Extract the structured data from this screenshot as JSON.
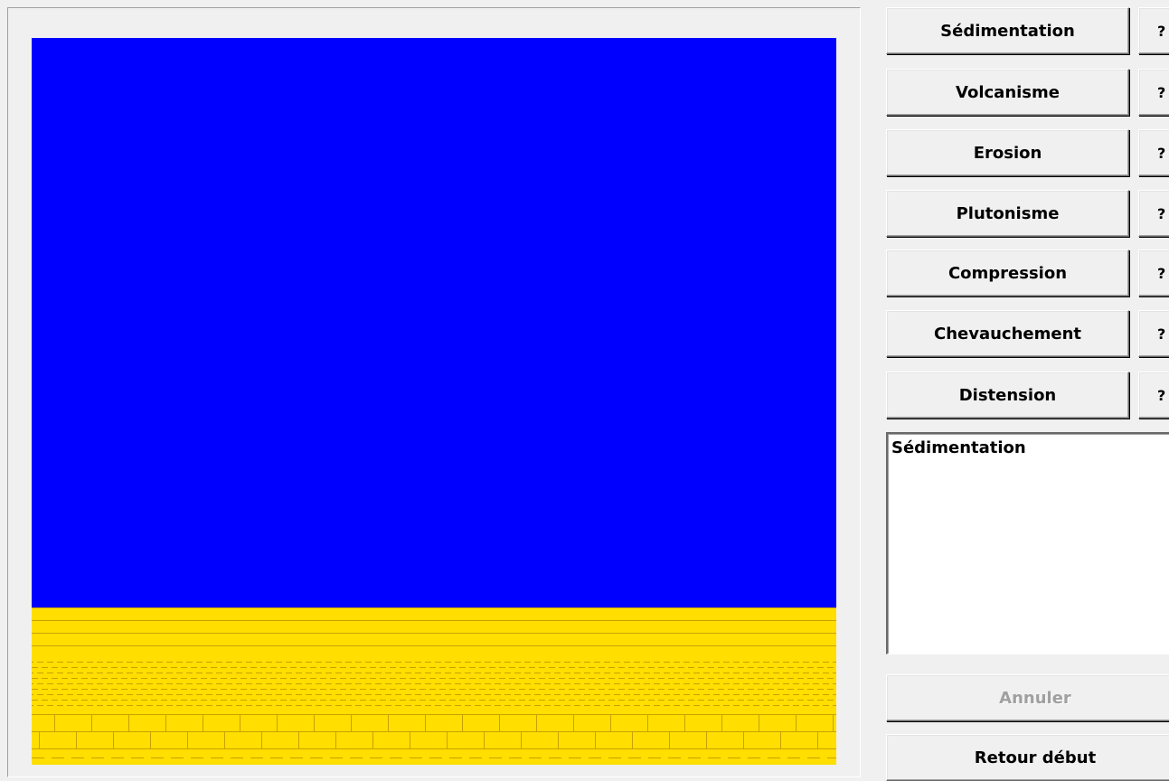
{
  "operations": [
    {
      "label": "Sédimentation",
      "help": "?"
    },
    {
      "label": "Volcanisme",
      "help": "?"
    },
    {
      "label": "Erosion",
      "help": "?"
    },
    {
      "label": "Plutonisme",
      "help": "?"
    },
    {
      "label": "Compression",
      "help": "?"
    },
    {
      "label": "Chevauchement",
      "help": "?"
    },
    {
      "label": "Distension",
      "help": "?"
    }
  ],
  "history": [
    "Sédimentation"
  ],
  "actions": {
    "undo_label": "Annuler",
    "undo_enabled": false,
    "restart_label": "Retour début"
  },
  "colors": {
    "sky_water": "#0000ff",
    "sediment": "#ffde00",
    "sediment_lines": "#c8a200"
  },
  "strata": [
    {
      "type": "horizontal-lines",
      "pattern": "sandstone"
    },
    {
      "type": "dashed-lines",
      "pattern": "clay"
    },
    {
      "type": "brick",
      "pattern": "limestone"
    }
  ]
}
